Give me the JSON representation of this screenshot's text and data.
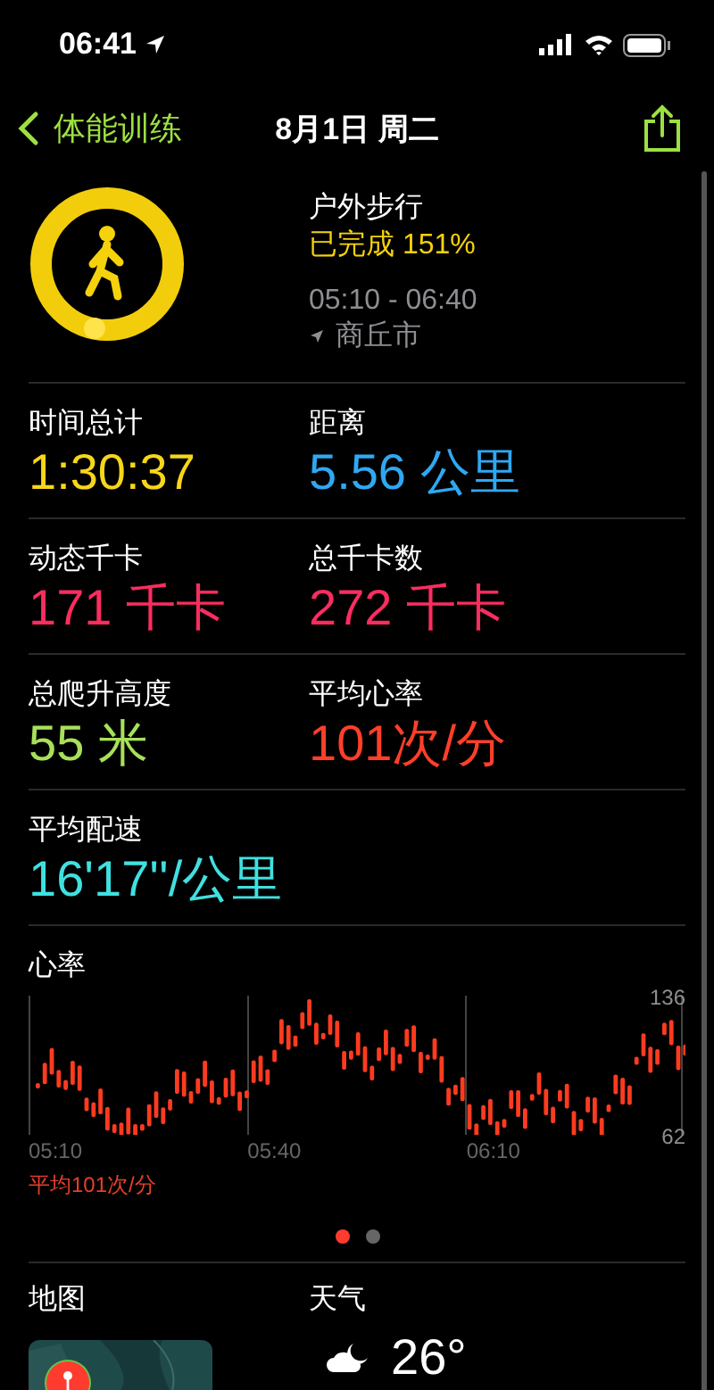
{
  "status_bar": {
    "time": "06:41"
  },
  "nav": {
    "back": "体能训练",
    "title": "8月1日 周二"
  },
  "workout": {
    "name": "户外步行",
    "progress": "已完成 151%",
    "time_range": "05:10 - 06:40",
    "location": "商丘市"
  },
  "metrics": [
    {
      "label": "时间总计",
      "value": "1:30:37",
      "color": "#f7d619"
    },
    {
      "label": "距离",
      "value": "5.56 公里",
      "color": "#2fa8f2"
    },
    {
      "label": "动态千卡",
      "value": "171 千卡",
      "color": "#fa2d5f"
    },
    {
      "label": "总千卡数",
      "value": "272 千卡",
      "color": "#fa2d5f"
    },
    {
      "label": "总爬升高度",
      "value": "55 米",
      "color": "#a8e05a"
    },
    {
      "label": "平均心率",
      "value": "101次/分",
      "color": "#fe3f2a"
    },
    {
      "label": "平均配速",
      "value": "16'17''/公里",
      "color": "#40e0e0"
    }
  ],
  "heart_rate": {
    "title": "心率",
    "y_max": "136",
    "y_min": "62",
    "x_labels": [
      "05:10",
      "05:40",
      "06:10"
    ],
    "average": "平均101次/分"
  },
  "pages": [
    {
      "selected": true
    },
    {
      "selected": false
    }
  ],
  "bottom": {
    "map_title": "地图",
    "weather_title": "天气",
    "temperature": "26°"
  }
}
